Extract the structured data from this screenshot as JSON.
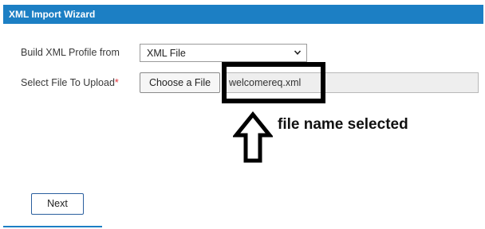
{
  "window": {
    "title": "XML Import Wizard"
  },
  "form": {
    "profile_label": "Build XML Profile from",
    "profile_selected": "XML File",
    "upload_label": "Select File To Upload",
    "required_marker": "*",
    "choose_button_label": "Choose a File",
    "file_name": "welcomereq.xml"
  },
  "annotation": {
    "text": "file name selected"
  },
  "footer": {
    "next_label": "Next"
  },
  "colors": {
    "titlebar": "#1c7fc4",
    "required": "#e0303a",
    "annotation": "#000000"
  }
}
